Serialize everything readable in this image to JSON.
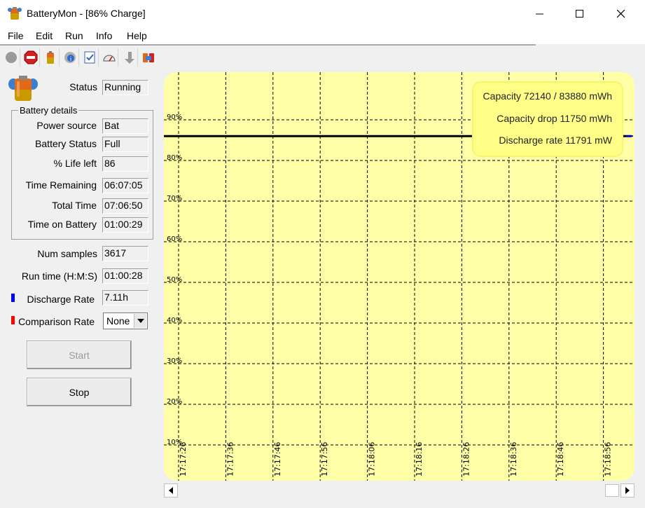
{
  "window": {
    "title": "BatteryMon - [86% Charge]"
  },
  "menu": [
    "File",
    "Edit",
    "Run",
    "Info",
    "Help"
  ],
  "toolbar": [
    {
      "icon": "record-icon"
    },
    {
      "icon": "stop-icon"
    },
    {
      "icon": "battery-icon"
    },
    {
      "icon": "info-gear-icon"
    },
    {
      "icon": "checklist-icon"
    },
    {
      "icon": "gauge-icon"
    },
    {
      "icon": "arrow-down-icon"
    },
    {
      "icon": "batteries-icon"
    }
  ],
  "status": {
    "label": "Status",
    "value": "Running"
  },
  "battery_details": {
    "title": "Battery details",
    "rows": [
      {
        "label": "Power source",
        "value": "Bat"
      },
      {
        "label": "Battery Status",
        "value": "Full"
      },
      {
        "label": "% Life left",
        "value": "86"
      },
      {
        "label": "Time Remaining",
        "value": "06:07:05"
      },
      {
        "label": "Total Time",
        "value": "07:06:50"
      },
      {
        "label": "Time on Battery",
        "value": "01:00:29"
      }
    ]
  },
  "stats": {
    "num_samples": {
      "label": "Num samples",
      "value": "3617"
    },
    "run_time": {
      "label": "Run time (H:M:S)",
      "value": "01:00:28"
    },
    "discharge_rate": {
      "label": "Discharge Rate",
      "value": "7.11h",
      "color": "#0000ff"
    },
    "comparison_rate": {
      "label": "Comparison Rate",
      "value": "None",
      "color": "#ff0000"
    }
  },
  "buttons": {
    "start": "Start",
    "stop": "Stop"
  },
  "colors": {
    "chart_bg": "#ffffa8",
    "legend_bg": "#ffff88",
    "series_line": "#000000"
  },
  "chart_data": {
    "type": "line",
    "y_ticks": [
      "90%",
      "80%",
      "70%",
      "60%",
      "50%",
      "40%",
      "30%",
      "20%",
      "10%"
    ],
    "x_ticks": [
      "17:17:26",
      "17:17:36",
      "17:17:46",
      "17:17:56",
      "17:18:06",
      "17:18:16",
      "17:18:26",
      "17:18:36",
      "17:18:46",
      "17:18:56"
    ],
    "series": [
      {
        "values": [
          86,
          86,
          86,
          86,
          86,
          86,
          86,
          86,
          86,
          86,
          86
        ]
      }
    ],
    "ylim": [
      10,
      100
    ],
    "grid": true,
    "legend": {
      "capacity": "Capacity 72140 / 83880 mWh",
      "capacity_drop": "Capacity drop 11750 mWh",
      "discharge_rate": "Discharge rate 11791 mW"
    }
  }
}
